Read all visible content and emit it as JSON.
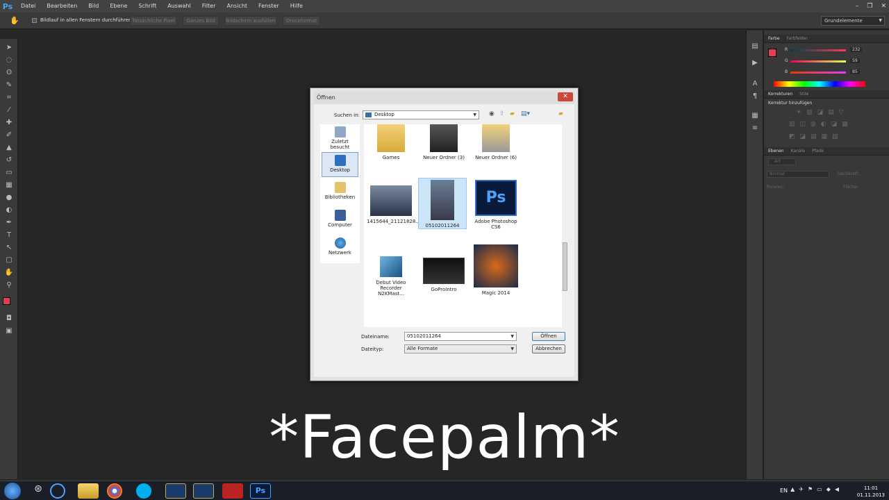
{
  "app": {
    "logo": "Ps"
  },
  "menu": [
    "Datei",
    "Bearbeiten",
    "Bild",
    "Ebene",
    "Schrift",
    "Auswahl",
    "Filter",
    "Ansicht",
    "Fenster",
    "Hilfe"
  ],
  "window_controls": [
    "–",
    "❐",
    "✕"
  ],
  "options_bar": {
    "scroll_all_label": "Bildlauf in allen Fenstern durchführen",
    "buttons": [
      "Tatsächliche Pixel",
      "Ganzes Bild",
      "Bildschirm ausfüllen",
      "Druckformat"
    ],
    "workspace": "Grundelemente"
  },
  "panels": {
    "color_tabs": [
      "Farbe",
      "Farbfelder"
    ],
    "rgb": {
      "r_label": "R",
      "g_label": "G",
      "b_label": "B",
      "r": "232",
      "g": "59",
      "b": "85"
    },
    "adjust_tabs": [
      "Korrekturen",
      "Stile"
    ],
    "adjust_title": "Korrektur hinzufügen",
    "layer_tabs": [
      "Ebenen",
      "Kanäle",
      "Pfade"
    ],
    "layer_kind": "Art",
    "blend_mode": "Normal",
    "opacity_label": "Deckkraft:",
    "lock_label": "Fixieren:",
    "fill_label": "Fläche:"
  },
  "dialog": {
    "title": "Öffnen",
    "look_in_label": "Suchen in:",
    "look_in_value": "Desktop",
    "places": [
      "Zuletzt besucht",
      "Desktop",
      "Bibliotheken",
      "Computer",
      "Netzwerk"
    ],
    "files": [
      {
        "name": "Games"
      },
      {
        "name": "Neuer Ordner (3)"
      },
      {
        "name": "Neuer Ordner (6)"
      },
      {
        "name": "1415644_21121828..."
      },
      {
        "name": "05102011264"
      },
      {
        "name": "Adobe Photoshop CS6",
        "thumb_text": "Ps"
      },
      {
        "name": "Debut Video Recorder N2KMast..."
      },
      {
        "name": "GoProIntro"
      },
      {
        "name": "Magic 2014"
      }
    ],
    "filename_label": "Dateiname:",
    "filename_value": "05102011264",
    "filetype_label": "Dateityp:",
    "filetype_value": "Alle Formate",
    "open_button": "Öffnen",
    "cancel_button": "Abbrechen"
  },
  "caption": "*Facepalm*",
  "taskbar": {
    "language": "EN",
    "time": "11:01",
    "date": "01.11.2013"
  },
  "colors": {
    "foreground": "#e83b55",
    "ps_blue": "#1f4fa8",
    "accent": "#4aa3ff"
  }
}
